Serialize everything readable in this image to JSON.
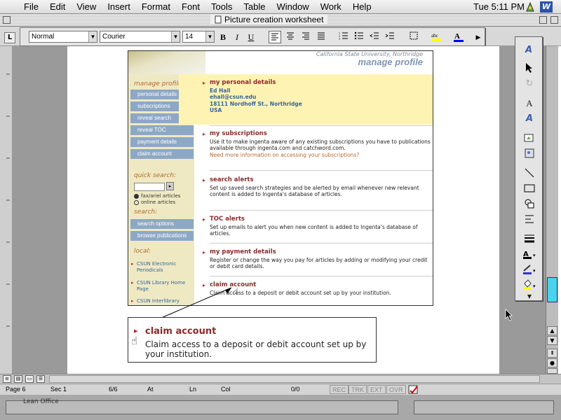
{
  "menubar": {
    "apple": "",
    "items": [
      "File",
      "Edit",
      "View",
      "Insert",
      "Format",
      "Font",
      "Tools",
      "Table",
      "Window",
      "Work",
      "Help"
    ],
    "clock": "Tue 5:11 PM"
  },
  "window": {
    "title": "Picture creation worksheet"
  },
  "toolbar": {
    "style_value": "Normal",
    "font_value": "Courier",
    "size_value": "14",
    "bold": "B",
    "italic": "I",
    "underline": "U"
  },
  "shot": {
    "university": "California State University, Northridge",
    "page_title": "manage profile",
    "nav": {
      "manage_heading": "manage profile:",
      "buttons": [
        "personal details",
        "subscriptions",
        "reveal search",
        "reveal TOC",
        "payment details",
        "claim account"
      ],
      "quick_heading": "quick search:",
      "go": "▸",
      "radio1": "fax/ariel articles",
      "radio2": "online articles",
      "search_heading": "search:",
      "search_buttons": [
        "search options",
        "browse publications"
      ],
      "local_heading": "local:",
      "local_links": [
        "CSUN Electronic Periodicals",
        "CSUN Library Home Page",
        "CSUN Interlibrary"
      ]
    },
    "sections": {
      "personal": {
        "title": "my personal details",
        "name": "Ed Hall",
        "email": "ehall@csun.edu",
        "address": "18111 Nordhoff St., Northridge",
        "country": "USA"
      },
      "subs": {
        "title": "my subscriptions",
        "body": "Use it to make ingenta aware of any existing subscriptions you have to publications available through ingenta.com and catchword.com.",
        "link": "Need more information on accessing your subscriptions?"
      },
      "alerts": {
        "title": "search alerts",
        "body": "Set up saved search strategies and be alerted by email whenever new relevant content is added to Ingenta's database of articles."
      },
      "toc": {
        "title": "TOC alerts",
        "body": "Set up emails to alert you when new content is added to Ingenta's database of articles."
      },
      "payment": {
        "title": "my payment details",
        "body": "Register or change the way you pay for articles by adding or modifying your credit or debit card details."
      },
      "claim": {
        "title": "claim account",
        "body": "Claim access to a deposit or debit account set up by your institution."
      }
    }
  },
  "callout": {
    "title": "claim account",
    "body": "Claim access to a deposit or debit account set up by your institution."
  },
  "status": {
    "page": "Page 6",
    "sec": "Sec 1",
    "pages": "6/6",
    "at": "At",
    "ln": "Ln",
    "col": "Col",
    "count": "0/0",
    "rec": "REC",
    "trk": "TRK",
    "ext": "EXT",
    "ovr": "OVR"
  },
  "launcher": {
    "label": "Lean Office"
  }
}
